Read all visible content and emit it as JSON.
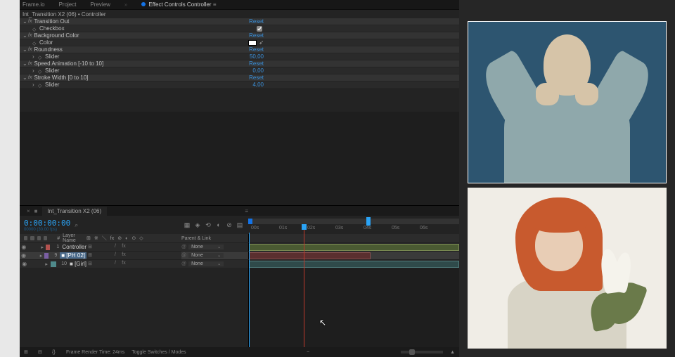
{
  "tabs": {
    "frameio": "Frame.io",
    "project": "Project",
    "preview": "Preview",
    "effect_controls": "Effect Controls Controller"
  },
  "ec": {
    "breadcrumb": "Int_Transition X2 (06) • Controller",
    "groups": {
      "transition_out": {
        "label": "Transition Out",
        "reset": "Reset"
      },
      "checkbox": {
        "label": "Checkbox",
        "checked": true
      },
      "background_color": {
        "label": "Background Color",
        "reset": "Reset"
      },
      "color": {
        "label": "Color"
      },
      "roundness": {
        "label": "Roundness",
        "reset": "Reset"
      },
      "roundness_slider": {
        "label": "Slider",
        "value": "50,00"
      },
      "speed": {
        "label": "Speed Animation [-10 to 10]",
        "reset": "Reset"
      },
      "speed_slider": {
        "label": "Slider",
        "value": "0,00"
      },
      "stroke": {
        "label": "Stroke Width [0 to 10]",
        "reset": "Reset"
      },
      "stroke_slider": {
        "label": "Slider",
        "value": "4,00"
      }
    }
  },
  "timeline": {
    "comp_name": "Int_Transition X2 (06)",
    "timecode": "0:00:00:00",
    "frame_info": "00000 (30.00 fps)",
    "col_layer": "Layer Name",
    "col_switches": "",
    "col_parent": "Parent & Link",
    "ruler": [
      "00s",
      "01s",
      "02s",
      "03s",
      "04s",
      "05s",
      "06s"
    ],
    "layers": [
      {
        "num": "1",
        "name": "Controller",
        "parent": "None",
        "selected": false,
        "chip": "red"
      },
      {
        "num": "9",
        "name": "■ [PH 02]",
        "parent": "None",
        "selected": true,
        "chip": "purple"
      },
      {
        "num": "10",
        "name": "■ [Girl]",
        "parent": "None",
        "selected": false,
        "chip": "teal"
      }
    ],
    "footer": {
      "render_time": "Frame Render Time: 24ms",
      "toggle": "Toggle Switches / Modes"
    }
  }
}
